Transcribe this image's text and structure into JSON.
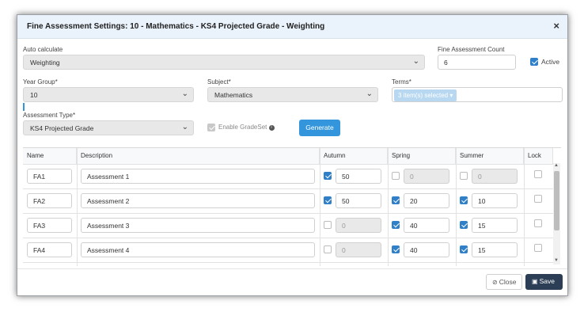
{
  "modal": {
    "title": "Fine Assessment Settings: 10 - Mathematics - KS4 Projected Grade - Weighting",
    "close_glyph": "×"
  },
  "form": {
    "auto_calculate": {
      "label": "Auto calculate",
      "value": "Weighting"
    },
    "fine_assessment_count": {
      "label": "Fine Assessment Count",
      "value": "6"
    },
    "active": {
      "label": "Active",
      "checked": true
    },
    "year_group": {
      "label": "Year Group*",
      "value": "10"
    },
    "subject": {
      "label": "Subject*",
      "value": "Mathematics"
    },
    "terms": {
      "label": "Terms*",
      "value": "3 item(s) selected"
    },
    "assessment_type": {
      "label": "Assessment Type*",
      "value": "KS4 Projected Grade"
    },
    "enable_gradeset": {
      "label": "Enable GradeSet",
      "checked": true,
      "info_icon": "info-circle-icon"
    },
    "generate_label": "Generate"
  },
  "table": {
    "headers": [
      "Name",
      "Description",
      "Autumn",
      "Spring",
      "Summer",
      "Lock"
    ],
    "rows": [
      {
        "name": "FA1",
        "description": "Assessment 1",
        "autumn_on": true,
        "autumn": "50",
        "spring_on": false,
        "spring": "0",
        "summer_on": false,
        "summer": "0"
      },
      {
        "name": "FA2",
        "description": "Assessment 2",
        "autumn_on": true,
        "autumn": "50",
        "spring_on": true,
        "spring": "20",
        "summer_on": true,
        "summer": "10"
      },
      {
        "name": "FA3",
        "description": "Assessment 3",
        "autumn_on": false,
        "autumn": "0",
        "spring_on": true,
        "spring": "40",
        "summer_on": true,
        "summer": "15"
      },
      {
        "name": "FA4",
        "description": "Assessment 4",
        "autumn_on": false,
        "autumn": "0",
        "spring_on": true,
        "spring": "40",
        "summer_on": true,
        "summer": "15"
      }
    ]
  },
  "footer": {
    "close_label": "Close",
    "close_icon": "ban-icon",
    "save_label": "Save",
    "save_icon": "floppy-disk-icon"
  },
  "colors": {
    "accent": "#3396dd",
    "header_bg": "#eaf3fb",
    "save_bg": "#2c3e55",
    "checkbox_on": "#2f80c8"
  }
}
